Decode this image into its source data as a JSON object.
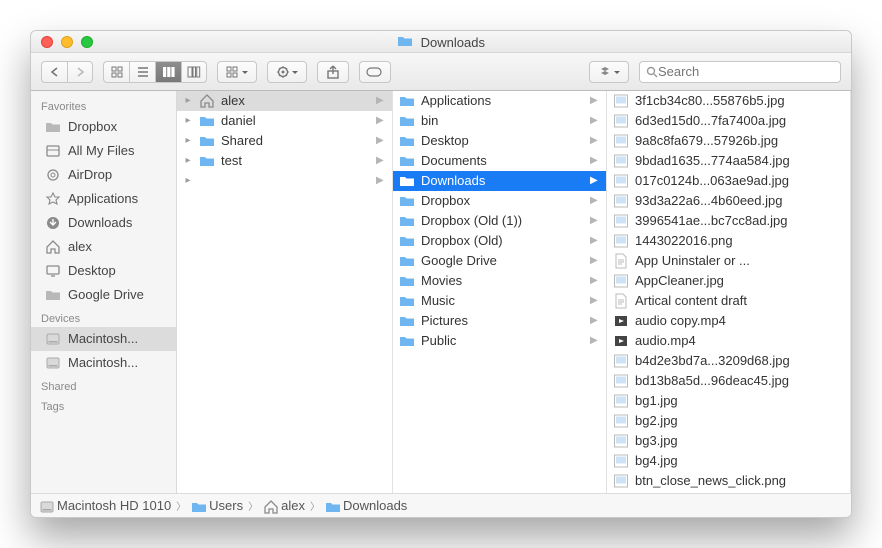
{
  "title": {
    "icon": "folder-blue",
    "text": "Downloads"
  },
  "toolbar": {
    "view_modes": [
      "icon",
      "list",
      "column",
      "gallery"
    ],
    "active_view": 2,
    "search_placeholder": "Search"
  },
  "sidebar": {
    "sections": [
      {
        "header": "Favorites",
        "items": [
          {
            "icon": "folder-grey",
            "label": "Dropbox"
          },
          {
            "icon": "allfiles",
            "label": "All My Files"
          },
          {
            "icon": "airdrop",
            "label": "AirDrop"
          },
          {
            "icon": "apps",
            "label": "Applications"
          },
          {
            "icon": "downloads",
            "label": "Downloads"
          },
          {
            "icon": "home",
            "label": "alex"
          },
          {
            "icon": "desktop",
            "label": "Desktop"
          },
          {
            "icon": "folder-grey",
            "label": "Google Drive"
          }
        ]
      },
      {
        "header": "Devices",
        "items": [
          {
            "icon": "hdd",
            "label": "Macintosh...",
            "active": true
          },
          {
            "icon": "hdd",
            "label": "Macintosh..."
          }
        ]
      },
      {
        "header": "Shared",
        "items": []
      },
      {
        "header": "Tags",
        "items": []
      }
    ]
  },
  "columns": [
    {
      "items": [
        {
          "icon": "home",
          "label": "alex",
          "arrow": true,
          "selected": "grey",
          "expander": true
        },
        {
          "icon": "folder-blue",
          "label": "daniel",
          "arrow": true,
          "expander": true
        },
        {
          "icon": "folder-blue",
          "label": "Shared",
          "arrow": true,
          "expander": true
        },
        {
          "icon": "folder-blue",
          "label": "test",
          "arrow": true,
          "expander": true
        },
        {
          "icon": "",
          "label": "",
          "arrow": true,
          "expander": true,
          "blankish": true
        }
      ]
    },
    {
      "items": [
        {
          "icon": "folder-blue",
          "label": "Applications",
          "arrow": true
        },
        {
          "icon": "folder-blue",
          "label": "bin",
          "arrow": true
        },
        {
          "icon": "folder-blue",
          "label": "Desktop",
          "arrow": true
        },
        {
          "icon": "folder-blue",
          "label": "Documents",
          "arrow": true
        },
        {
          "icon": "folder-blue",
          "label": "Downloads",
          "arrow": true,
          "selected": "blue"
        },
        {
          "icon": "folder-blue",
          "label": "Dropbox",
          "arrow": true
        },
        {
          "icon": "folder-blue",
          "label": "Dropbox (Old (1))",
          "arrow": true
        },
        {
          "icon": "folder-blue",
          "label": "Dropbox (Old)",
          "arrow": true
        },
        {
          "icon": "folder-blue",
          "label": "Google Drive",
          "arrow": true
        },
        {
          "icon": "folder-blue",
          "label": "Movies",
          "arrow": true
        },
        {
          "icon": "folder-blue",
          "label": "Music",
          "arrow": true
        },
        {
          "icon": "folder-blue",
          "label": "Pictures",
          "arrow": true
        },
        {
          "icon": "folder-blue",
          "label": "Public",
          "arrow": true
        }
      ]
    },
    {
      "items": [
        {
          "icon": "img",
          "label": "3f1cb34c80...55876b5.jpg"
        },
        {
          "icon": "img",
          "label": "6d3ed15d0...7fa7400a.jpg"
        },
        {
          "icon": "img",
          "label": "9a8c8fa679...57926b.jpg"
        },
        {
          "icon": "img",
          "label": "9bdad1635...774aa584.jpg"
        },
        {
          "icon": "img",
          "label": "017c0124b...063ae9ad.jpg"
        },
        {
          "icon": "img",
          "label": "93d3a22a6...4b60eed.jpg"
        },
        {
          "icon": "img",
          "label": "3996541ae...bc7cc8ad.jpg"
        },
        {
          "icon": "img",
          "label": "1443022016.png"
        },
        {
          "icon": "doc",
          "label": "App Uninstaler or ..."
        },
        {
          "icon": "img",
          "label": "AppCleaner.jpg"
        },
        {
          "icon": "doc",
          "label": "Artical content draft"
        },
        {
          "icon": "mov",
          "label": "audio copy.mp4"
        },
        {
          "icon": "mov",
          "label": "audio.mp4"
        },
        {
          "icon": "img",
          "label": "b4d2e3bd7a...3209d68.jpg"
        },
        {
          "icon": "img",
          "label": "bd13b8a5d...96deac45.jpg"
        },
        {
          "icon": "img",
          "label": "bg1.jpg"
        },
        {
          "icon": "img",
          "label": "bg2.jpg"
        },
        {
          "icon": "img",
          "label": "bg3.jpg"
        },
        {
          "icon": "img",
          "label": "bg4.jpg"
        },
        {
          "icon": "img",
          "label": "btn_close_news_click.png"
        }
      ]
    }
  ],
  "pathbar": [
    {
      "icon": "hdd",
      "label": "Macintosh HD 1010"
    },
    {
      "icon": "folder-blue",
      "label": "Users"
    },
    {
      "icon": "home",
      "label": "alex"
    },
    {
      "icon": "folder-blue",
      "label": "Downloads"
    }
  ]
}
